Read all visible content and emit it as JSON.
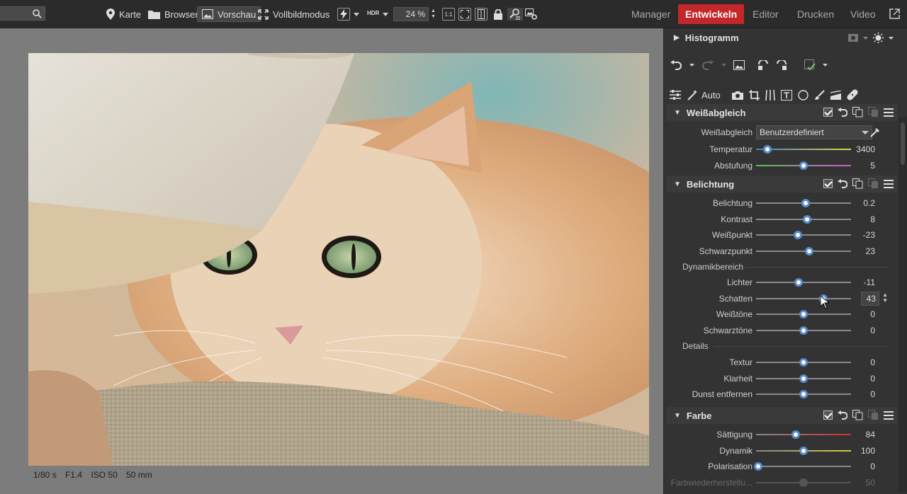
{
  "toolbar": {
    "search_placeholder": "",
    "nav_map": "Karte",
    "nav_browser": "Browser",
    "nav_preview": "Vorschau",
    "nav_fullscreen": "Vollbildmodus",
    "hdr_label": "HDR",
    "zoom_value": "24 %",
    "ratio_label": "1:1",
    "modules": [
      "Manager",
      "Entwickeln",
      "Editor",
      "Drucken",
      "Video"
    ],
    "active_module": "Entwickeln"
  },
  "exif": {
    "shutter": "1/80 s",
    "aperture": "F1.4",
    "iso": "ISO 50",
    "focal": "50 mm"
  },
  "panel": {
    "histogram_title": "Histogramm",
    "tools_auto_label": "Auto",
    "white_balance": {
      "title": "Weißabgleich",
      "preset_label": "Weißabgleich",
      "preset_value": "Benutzerdefiniert",
      "rows": [
        {
          "label": "Temperatur",
          "value": "3400",
          "level": 0.12
        },
        {
          "label": "Abstufung",
          "value": "5",
          "level": 0.5
        }
      ]
    },
    "exposure": {
      "title": "Belichtung",
      "rows": [
        {
          "label": "Belichtung",
          "value": "0.2",
          "level": 0.52
        },
        {
          "label": "Kontrast",
          "value": "8",
          "level": 0.54
        },
        {
          "label": "Weißpunkt",
          "value": "-23",
          "level": 0.44
        },
        {
          "label": "Schwarzpunkt",
          "value": "23",
          "level": 0.56
        }
      ],
      "dynamic_range_label": "Dynamikbereich",
      "dynamic_rows": [
        {
          "label": "Lichter",
          "value": "-11",
          "level": 0.45
        },
        {
          "label": "Schatten",
          "value": "43",
          "level": 0.71
        },
        {
          "label": "Weißtöne",
          "value": "0",
          "level": 0.5
        },
        {
          "label": "Schwarztöne",
          "value": "0",
          "level": 0.5
        }
      ],
      "details_label": "Details",
      "detail_rows": [
        {
          "label": "Textur",
          "value": "0",
          "level": 0.5
        },
        {
          "label": "Klarheit",
          "value": "0",
          "level": 0.5
        },
        {
          "label": "Dunst entfernen",
          "value": "0",
          "level": 0.5
        }
      ]
    },
    "color": {
      "title": "Farbe",
      "rows": [
        {
          "label": "Sättigung",
          "value": "84",
          "level": 0.42
        },
        {
          "label": "Dynamik",
          "value": "100",
          "level": 0.5
        },
        {
          "label": "Polarisation",
          "value": "0",
          "level": 0.02
        },
        {
          "label": "Farbwiederherstellu...",
          "value": "50",
          "level": 0.5
        }
      ]
    }
  },
  "colors": {
    "accent": "#c4272a",
    "knob_ring": "#5a8ccc",
    "panel_bg": "#333333",
    "canvas_bg": "#7c7c7c"
  }
}
